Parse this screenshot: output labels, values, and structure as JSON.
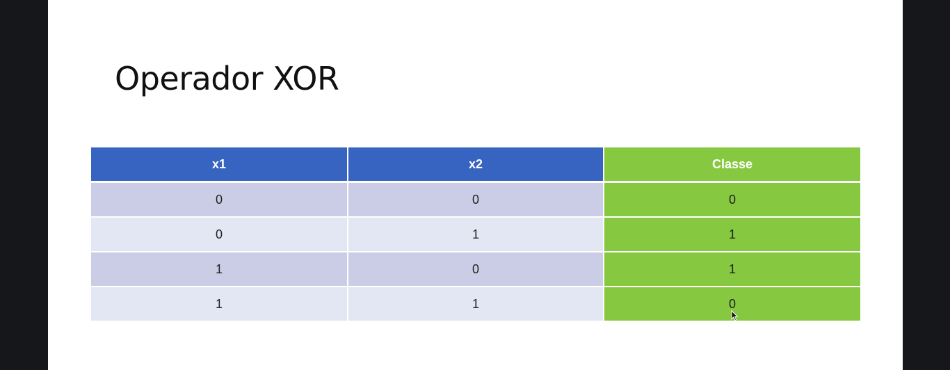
{
  "slide": {
    "title": "Operador XOR"
  },
  "table": {
    "columns": [
      "x1",
      "x2",
      "Classe"
    ],
    "rows": [
      [
        "0",
        "0",
        "0"
      ],
      [
        "0",
        "1",
        "1"
      ],
      [
        "1",
        "0",
        "1"
      ],
      [
        "1",
        "1",
        "0"
      ]
    ]
  },
  "colors": {
    "background": "#16171b",
    "slide": "#ffffff",
    "header_blue": "#3864c1",
    "class_green": "#86c940",
    "row_odd": "#cbcde6",
    "row_even": "#e3e6f3"
  },
  "icons": {
    "cursor": "mouse-pointer-icon"
  }
}
